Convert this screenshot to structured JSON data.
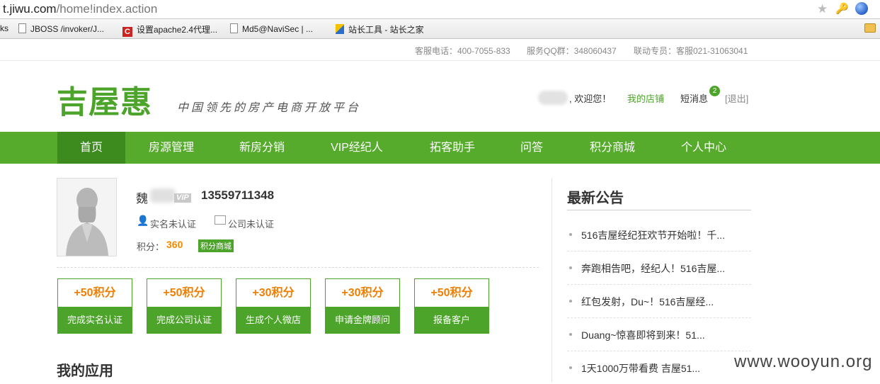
{
  "browser": {
    "url_host": "t.jiwu.com",
    "url_path": "/home!index.action",
    "bookmarks": [
      {
        "label": "ks"
      },
      {
        "label": "JBOSS /invoker/J..."
      },
      {
        "label": "设置apache2.4代理..."
      },
      {
        "label": "Md5@NaviSec | ..."
      },
      {
        "label": "站长工具 - 站长之家"
      }
    ]
  },
  "topbar": {
    "hotline": "客服电话：400-7055-833",
    "qq": "服务QQ群：348060437",
    "contact": "联动专员：客服021-31063041"
  },
  "header": {
    "logo": "吉屋惠",
    "slogan": "中国领先的房产电商开放平台",
    "welcome": ", 欢迎您！",
    "my_store": "我的店铺",
    "messages": "短消息",
    "message_count": "2",
    "logout": "[退出]"
  },
  "nav": {
    "items": [
      {
        "label": "首页",
        "active": true
      },
      {
        "label": "房源管理"
      },
      {
        "label": "新房分销"
      },
      {
        "label": "VIP经纪人"
      },
      {
        "label": "拓客助手"
      },
      {
        "label": "问答"
      },
      {
        "label": "积分商城"
      },
      {
        "label": "个人中心"
      }
    ]
  },
  "profile": {
    "name": "魏",
    "vip": "VIP",
    "phone": "13559711348",
    "realname_status": "实名未认证",
    "company_status": "公司未认证",
    "points_label": "积分：",
    "points": "360",
    "mall_button": "积分商城"
  },
  "tasks": [
    {
      "points": "+50积分",
      "label": "完成实名认证"
    },
    {
      "points": "+50积分",
      "label": "完成公司认证"
    },
    {
      "points": "+30积分",
      "label": "生成个人微店"
    },
    {
      "points": "+30积分",
      "label": "申请金牌顾问"
    },
    {
      "points": "+50积分",
      "label": "报备客户"
    }
  ],
  "apps": {
    "title": "我的应用"
  },
  "notices": {
    "title": "最新公告",
    "items": [
      "516吉屋经纪狂欢节开始啦！千...",
      "奔跑相告吧，经纪人！516吉屋...",
      "红包发射，Du~！516吉屋经...",
      "Duang~惊喜即将到来！51...",
      "1天1000万带看费 吉屋51..."
    ]
  },
  "watermark": "www.wooyun.org",
  "colors": {
    "brand_green": "#56aa2c",
    "nav_active": "#3d8a1f",
    "points_orange": "#f08a00"
  }
}
